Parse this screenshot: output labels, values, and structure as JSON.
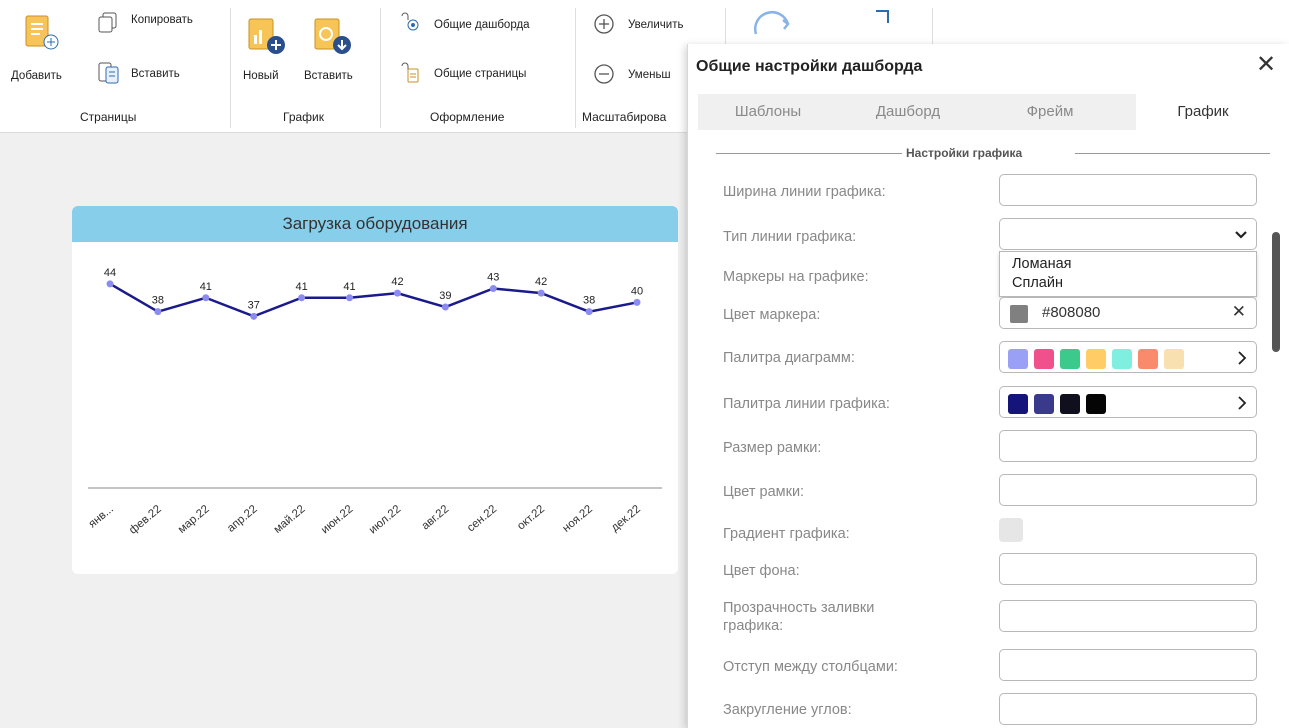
{
  "ribbon": {
    "pages": {
      "add_label": "Добавить",
      "copy_label": "Копировать",
      "paste_label": "Вставить",
      "group_label": "Страницы"
    },
    "chart": {
      "new_label": "Новый",
      "paste_label": "Вставить",
      "group_label": "График"
    },
    "design": {
      "shared_dashboards_label": "Общие дашборда",
      "shared_pages_label": "Общие страницы",
      "group_label": "Оформление"
    },
    "scale": {
      "zoom_in_label": "Увеличить",
      "zoom_out_label": "Уменьш",
      "group_label": "Масштабирова"
    }
  },
  "card": {
    "title": "Загрузка оборудования"
  },
  "chart_data": {
    "type": "line",
    "title": "Загрузка оборудования",
    "categories": [
      "янв...",
      "фев.22",
      "мар.22",
      "апр.22",
      "май.22",
      "июн.22",
      "июл.22",
      "авг.22",
      "сен.22",
      "окт.22",
      "ноя.22",
      "дек.22"
    ],
    "series": [
      {
        "values": [
          44,
          38,
          41,
          37,
          41,
          41,
          42,
          39,
          43,
          42,
          38,
          40
        ]
      }
    ],
    "ylim": [
      0,
      50
    ],
    "line_color": "#1a1a8c",
    "marker_color": "#8c8cf0",
    "grid": false,
    "data_labels": true
  },
  "dialog": {
    "title": "Общие настройки дашборда",
    "close_glyph": "✕",
    "tabs": [
      "Шаблоны",
      "Дашборд",
      "Фрейм",
      "График"
    ],
    "active_tab": "График",
    "section_title": "Настройки графика",
    "fields": {
      "line_width": "Ширина линии графика:",
      "line_type": "Тип линии графика:",
      "markers": "Маркеры на графике:",
      "marker_color": "Цвет маркера:",
      "palette": "Палитра диаграмм:",
      "line_palette": "Палитра линии графика:",
      "border_size": "Размер рамки:",
      "border_color": "Цвет рамки:",
      "gradient": "Градиент графика:",
      "background_color": "Цвет фона:",
      "fill_opacity_line1": "Прозрачность заливки",
      "fill_opacity_line2": "графика:",
      "column_gap": "Отступ между столбцами:",
      "partial_next": "Закругление углов:"
    },
    "line_type_options": [
      "Ломаная",
      "Сплайн"
    ],
    "marker_color_value": "#808080",
    "palette_colors": [
      "#9aa0f5",
      "#f0508c",
      "#3cc98c",
      "#ffcc66",
      "#7ff0e0",
      "#f98a6c",
      "#f8e0b0"
    ],
    "line_palette_colors": [
      "#14147a",
      "#3a3a8c",
      "#0f0f1e",
      "#050505"
    ]
  }
}
